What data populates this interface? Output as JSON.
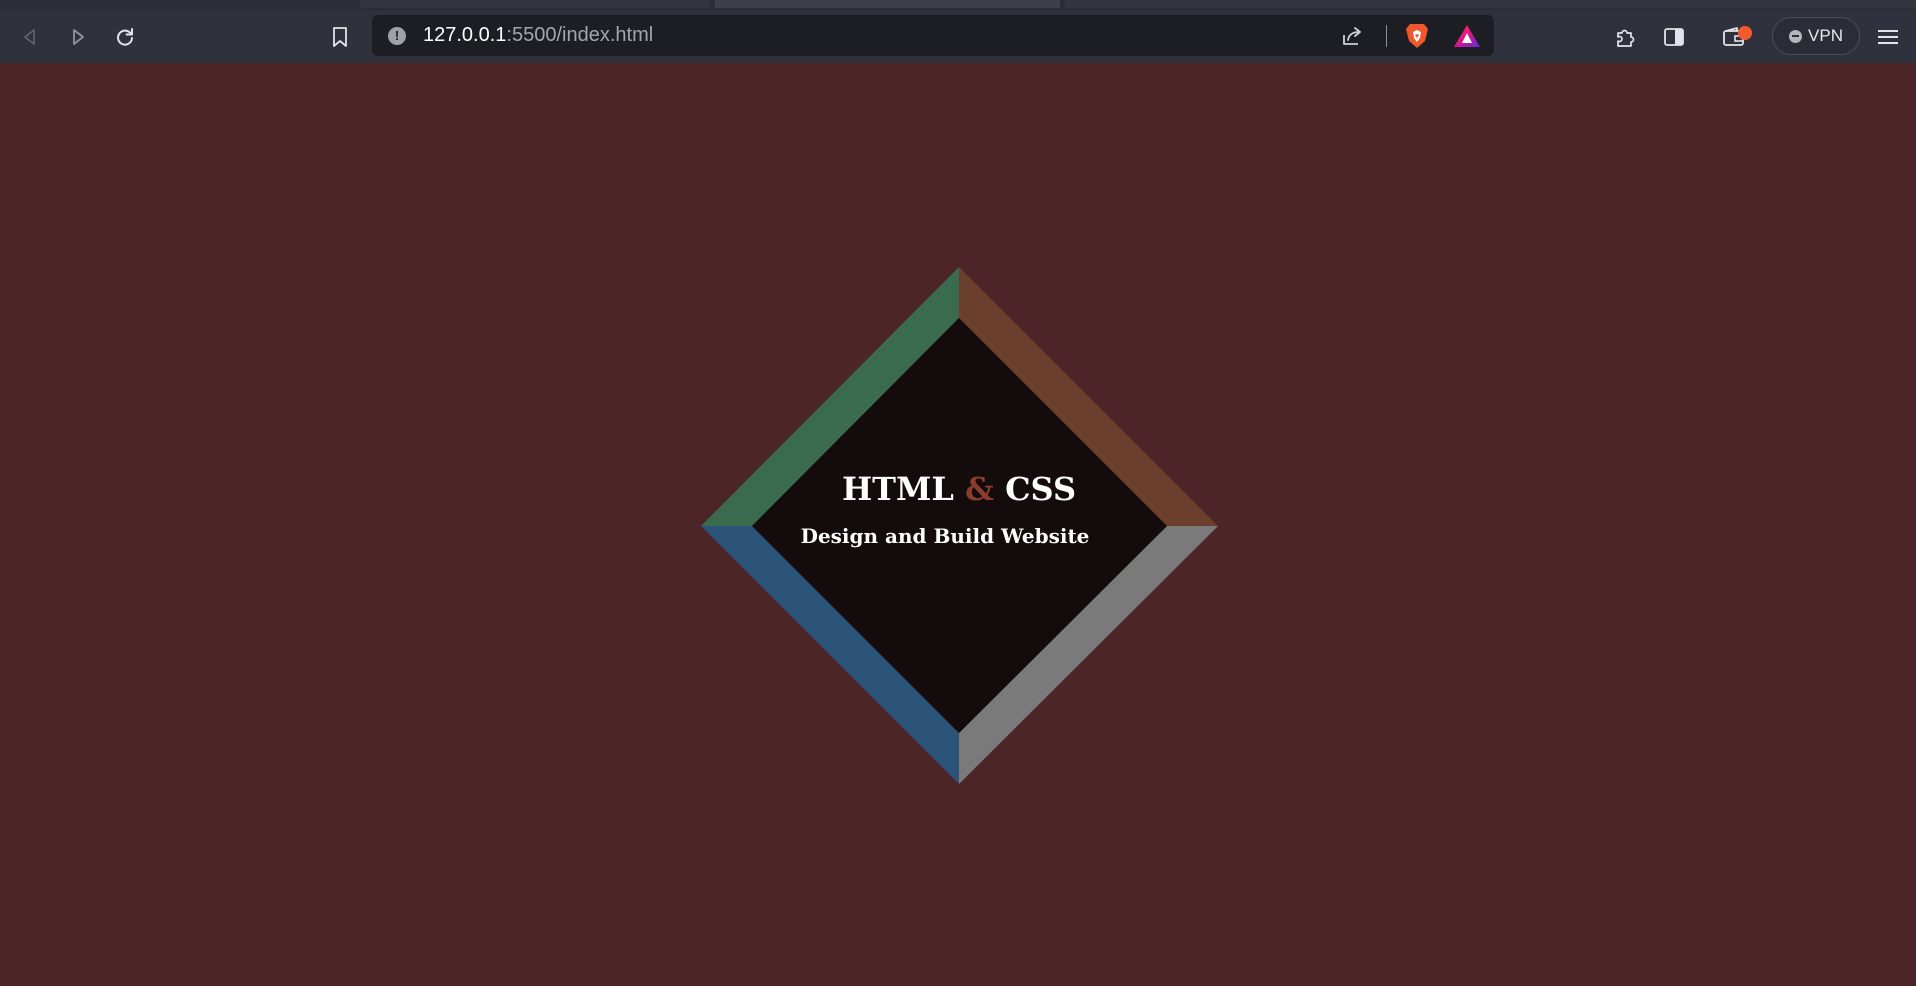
{
  "browser": {
    "url_host": "127.0.0.1",
    "url_rest": ":5500/index.html",
    "vpn_label": "VPN",
    "icons": {
      "back": "back-arrow-icon",
      "forward": "forward-arrow-icon",
      "reload": "reload-icon",
      "bookmark": "bookmark-icon",
      "site_info": "info-icon",
      "share": "share-icon",
      "brave_shields": "brave-lion-icon",
      "rewards": "brave-rewards-triangle-icon",
      "extensions": "puzzle-icon",
      "sidebar": "sidebar-icon",
      "wallet": "wallet-icon",
      "menu": "hamburger-menu-icon"
    },
    "colors": {
      "toolbar": "#2f323c",
      "omnibox": "#1c1e24",
      "notification_dot": "#f25a2b"
    }
  },
  "page": {
    "title_part1": "HTML",
    "title_amp": "&",
    "title_part2": "CSS",
    "subtitle": "Design and Build Website",
    "colors": {
      "background": "#4b2528",
      "inner": "#140c0c",
      "top_left": "#3b6b4e",
      "top_right": "#6b3f2b",
      "bottom_left": "#2c5478",
      "bottom_right": "#7a7a7a",
      "ampersand": "#8b3d2c"
    }
  }
}
